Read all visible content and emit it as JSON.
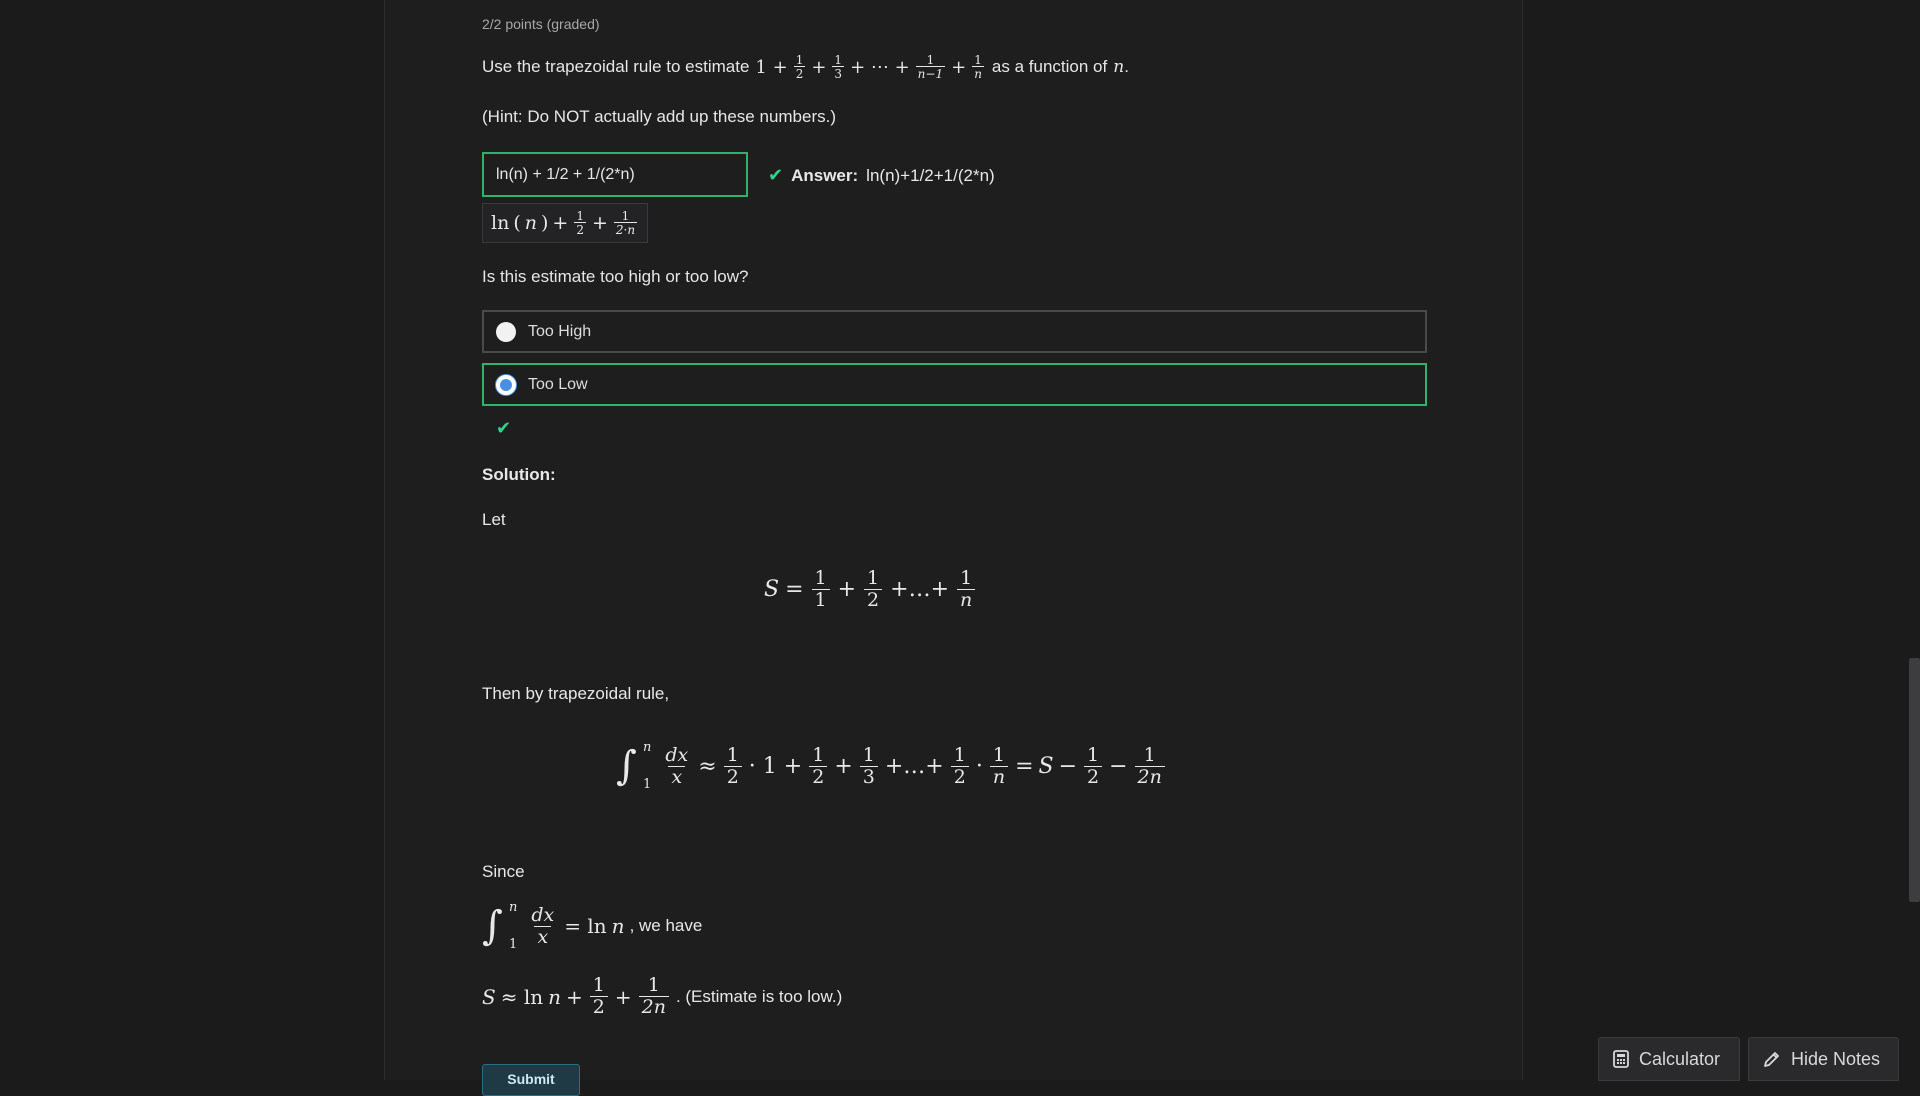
{
  "problem": {
    "points": "2/2 points (graded)",
    "prompt_before": "Use the trapezoidal rule to estimate",
    "prompt_after": "as a function of",
    "prompt_var": "n",
    "prompt_end": ".",
    "hint": "(Hint: Do NOT actually add up these numbers.)"
  },
  "answer": {
    "input_value": "ln(n) + 1/2 + 1/(2*n)",
    "feedback_label": "Answer:",
    "feedback_value": "ln(n)+1/2+1/(2*n)"
  },
  "question2": {
    "prompt": "Is this estimate too high or too low?",
    "choices": [
      {
        "label": "Too High",
        "selected": false
      },
      {
        "label": "Too Low",
        "selected": true
      }
    ]
  },
  "solution": {
    "heading": "Solution:",
    "let": "Let",
    "then": "Then by trapezoidal rule,",
    "since": "Since",
    "we_have": ", we have",
    "estimate_note": ". (Estimate is too low.)"
  },
  "footer": {
    "submit_label": "Submit"
  },
  "tools": {
    "calculator_label": "Calculator",
    "notes_label": "Hide Notes",
    "calculator_icon": "calculator-icon",
    "notes_icon": "pencil-icon"
  },
  "colors": {
    "correct": "#2fb26b",
    "check": "#2fd389",
    "radio_selected": "#4a90e2"
  }
}
